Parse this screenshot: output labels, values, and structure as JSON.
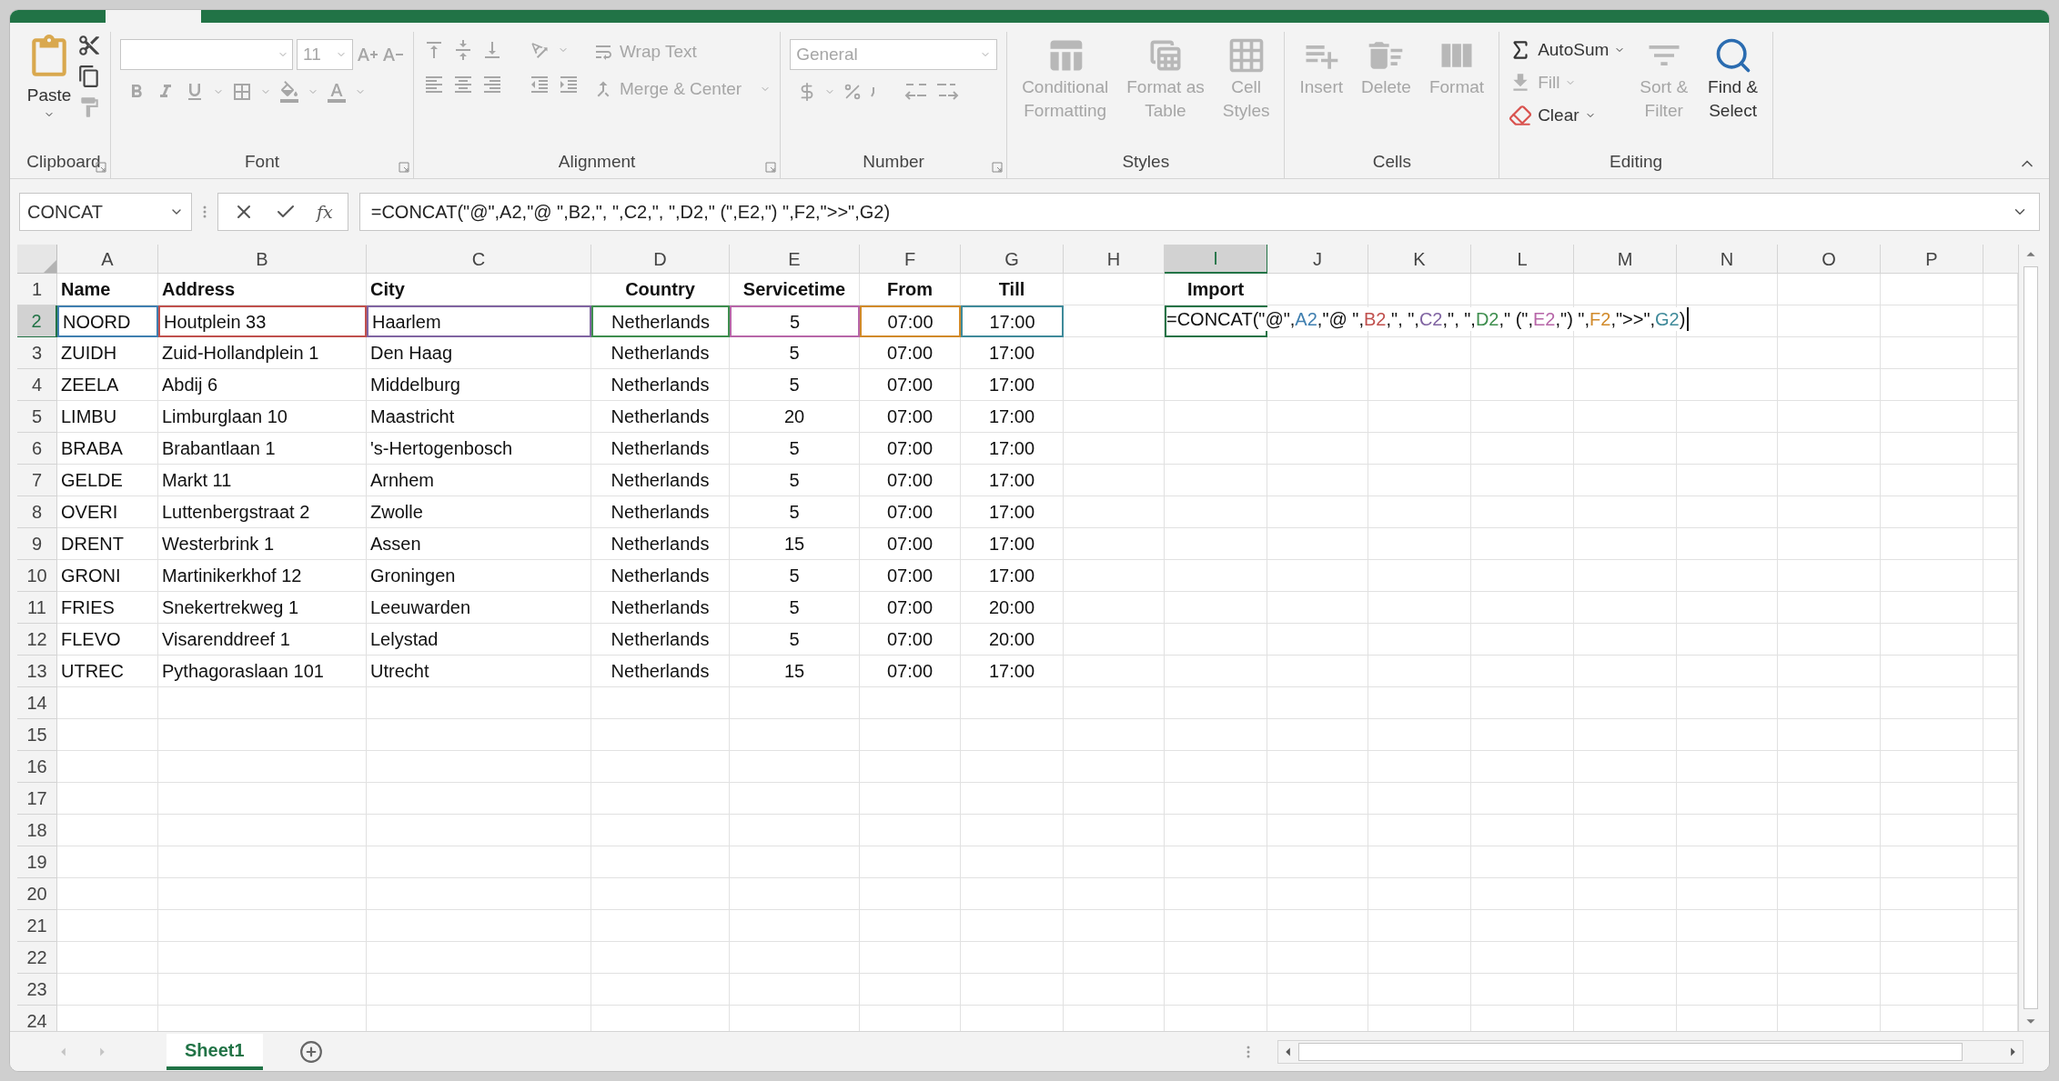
{
  "ribbon": {
    "groups": [
      {
        "kind": "clipboard",
        "label": "Clipboard",
        "launcher": true,
        "paste": {
          "label": "Paste",
          "disabled": false
        },
        "tools": [
          {
            "kind": "cut",
            "disabled": false
          },
          {
            "kind": "copy",
            "disabled": false
          },
          {
            "kind": "painter",
            "disabled": true
          }
        ]
      },
      {
        "kind": "font",
        "label": "Font",
        "launcher": true,
        "disabled": true,
        "font_size": "11"
      },
      {
        "kind": "alignment",
        "label": "Alignment",
        "launcher": true,
        "disabled": true,
        "wrap": "Wrap Text",
        "merge": "Merge & Center"
      },
      {
        "kind": "number",
        "label": "Number",
        "launcher": true,
        "disabled": true,
        "format": "General"
      },
      {
        "kind": "styles",
        "label": "Styles",
        "buttons": [
          {
            "kind": "conditional",
            "lines": [
              "Conditional",
              "Formatting"
            ],
            "disabled": true
          },
          {
            "kind": "table",
            "lines": [
              "Format as",
              "Table"
            ],
            "disabled": true
          },
          {
            "kind": "cellstyles",
            "lines": [
              "Cell",
              "Styles"
            ],
            "disabled": true
          }
        ]
      },
      {
        "kind": "cells",
        "label": "Cells",
        "buttons": [
          {
            "kind": "insert",
            "lines": [
              "Insert"
            ],
            "disabled": true
          },
          {
            "kind": "delete",
            "lines": [
              "Delete"
            ],
            "disabled": true
          },
          {
            "kind": "format",
            "lines": [
              "Format"
            ],
            "disabled": true
          }
        ]
      },
      {
        "kind": "editing",
        "label": "Editing",
        "small": [
          {
            "kind": "autosum",
            "label": "AutoSum",
            "disabled": false
          },
          {
            "kind": "fill",
            "label": "Fill",
            "disabled": true
          },
          {
            "kind": "clear",
            "label": "Clear",
            "disabled": false
          }
        ],
        "buttons": [
          {
            "kind": "sort",
            "lines": [
              "Sort &",
              "Filter"
            ],
            "disabled": true
          },
          {
            "kind": "find",
            "lines": [
              "Find &",
              "Select"
            ],
            "disabled": false
          }
        ]
      }
    ]
  },
  "formula_bar": {
    "name_box": "CONCAT",
    "fx": "fx",
    "formula": "=CONCAT(\"@\",A2,\"@ \",B2,\", \",C2,\", \",D2,\" (\",E2,\") \",F2,\">>\",G2)"
  },
  "sheet": {
    "columns": [
      {
        "label": "A",
        "selected": false
      },
      {
        "label": "B",
        "selected": false
      },
      {
        "label": "C",
        "selected": false
      },
      {
        "label": "D",
        "selected": false
      },
      {
        "label": "E",
        "selected": false
      },
      {
        "label": "F",
        "selected": false
      },
      {
        "label": "G",
        "selected": false
      },
      {
        "label": "H",
        "selected": false
      },
      {
        "label": "I",
        "selected": true
      },
      {
        "label": "J",
        "selected": false
      },
      {
        "label": "K",
        "selected": false
      },
      {
        "label": "L",
        "selected": false
      },
      {
        "label": "M",
        "selected": false
      },
      {
        "label": "N",
        "selected": false
      },
      {
        "label": "O",
        "selected": false
      },
      {
        "label": "P",
        "selected": false
      }
    ],
    "rows": [
      {
        "label": "1",
        "selected": false,
        "kind": "header",
        "cells": [
          "Name",
          "Address",
          "City",
          "Country",
          "Servicetime",
          "From",
          "Till",
          null,
          "Import"
        ]
      },
      {
        "label": "2",
        "selected": true,
        "kind": "data",
        "cells": [
          "NOORD",
          "Houtplein 33",
          "Haarlem",
          "Netherlands",
          "5",
          "07:00",
          "17:00"
        ],
        "cell_highlights": [
          {
            "color": "#3f7fb0"
          },
          {
            "color": "#c0504d"
          },
          {
            "color": "#8064a2"
          },
          {
            "color": "#3e8e4e"
          },
          {
            "color": "#b766a8"
          },
          {
            "color": "#d18a2a"
          },
          {
            "color": "#3f8a9a"
          }
        ],
        "editing": {
          "tokens": [
            {
              "kind": "text",
              "text": "=CONCAT(\"@\","
            },
            {
              "kind": "ref",
              "text": "A2",
              "color": "#3f7fb0"
            },
            {
              "kind": "text",
              "text": ",\"@ \","
            },
            {
              "kind": "ref",
              "text": "B2",
              "color": "#c0504d"
            },
            {
              "kind": "text",
              "text": ",\", \","
            },
            {
              "kind": "ref",
              "text": "C2",
              "color": "#8064a2"
            },
            {
              "kind": "text",
              "text": ",\", \","
            },
            {
              "kind": "ref",
              "text": "D2",
              "color": "#3e8e4e"
            },
            {
              "kind": "text",
              "text": ",\" (\","
            },
            {
              "kind": "ref",
              "text": "E2",
              "color": "#b766a8"
            },
            {
              "kind": "text",
              "text": ",\") \","
            },
            {
              "kind": "ref",
              "text": "F2",
              "color": "#d18a2a"
            },
            {
              "kind": "text",
              "text": ",\">>\","
            },
            {
              "kind": "ref",
              "text": "G2",
              "color": "#3f8a9a"
            },
            {
              "kind": "text",
              "text": ")"
            }
          ]
        }
      },
      {
        "label": "3",
        "selected": false,
        "kind": "data",
        "cells": [
          "ZUIDH",
          "Zuid-Hollandplein 1",
          "Den Haag",
          "Netherlands",
          "5",
          "07:00",
          "17:00"
        ]
      },
      {
        "label": "4",
        "selected": false,
        "kind": "data",
        "cells": [
          "ZEELA",
          "Abdij 6",
          "Middelburg",
          "Netherlands",
          "5",
          "07:00",
          "17:00"
        ]
      },
      {
        "label": "5",
        "selected": false,
        "kind": "data",
        "cells": [
          "LIMBU",
          "Limburglaan 10",
          "Maastricht",
          "Netherlands",
          "20",
          "07:00",
          "17:00"
        ]
      },
      {
        "label": "6",
        "selected": false,
        "kind": "data",
        "cells": [
          "BRABA",
          "Brabantlaan 1",
          "'s-Hertogenbosch",
          "Netherlands",
          "5",
          "07:00",
          "17:00"
        ]
      },
      {
        "label": "7",
        "selected": false,
        "kind": "data",
        "cells": [
          "GELDE",
          "Markt 11",
          "Arnhem",
          "Netherlands",
          "5",
          "07:00",
          "17:00"
        ]
      },
      {
        "label": "8",
        "selected": false,
        "kind": "data",
        "cells": [
          "OVERI",
          "Luttenbergstraat 2",
          "Zwolle",
          "Netherlands",
          "5",
          "07:00",
          "17:00"
        ]
      },
      {
        "label": "9",
        "selected": false,
        "kind": "data",
        "cells": [
          "DRENT",
          "Westerbrink 1",
          "Assen",
          "Netherlands",
          "15",
          "07:00",
          "17:00"
        ]
      },
      {
        "label": "10",
        "selected": false,
        "kind": "data",
        "cells": [
          "GRONI",
          "Martinikerkhof 12",
          "Groningen",
          "Netherlands",
          "5",
          "07:00",
          "17:00"
        ]
      },
      {
        "label": "11",
        "selected": false,
        "kind": "data",
        "cells": [
          "FRIES",
          "Snekertrekweg 1",
          "Leeuwarden",
          "Netherlands",
          "5",
          "07:00",
          "20:00"
        ]
      },
      {
        "label": "12",
        "selected": false,
        "kind": "data",
        "cells": [
          "FLEVO",
          "Visarenddreef 1",
          "Lelystad",
          "Netherlands",
          "5",
          "07:00",
          "20:00"
        ]
      },
      {
        "label": "13",
        "selected": false,
        "kind": "data",
        "cells": [
          "UTREC",
          "Pythagoraslaan 101",
          "Utrecht",
          "Netherlands",
          "15",
          "07:00",
          "17:00"
        ]
      },
      {
        "label": "14",
        "selected": false,
        "kind": "data"
      },
      {
        "label": "15",
        "selected": false,
        "kind": "data"
      },
      {
        "label": "16",
        "selected": false,
        "kind": "data"
      },
      {
        "label": "17",
        "selected": false,
        "kind": "data"
      },
      {
        "label": "18",
        "selected": false,
        "kind": "data"
      },
      {
        "label": "19",
        "selected": false,
        "kind": "data"
      },
      {
        "label": "20",
        "selected": false,
        "kind": "data"
      },
      {
        "label": "21",
        "selected": false,
        "kind": "data"
      },
      {
        "label": "22",
        "selected": false,
        "kind": "data"
      },
      {
        "label": "23",
        "selected": false,
        "kind": "data"
      },
      {
        "label": "24",
        "selected": false,
        "kind": "data"
      }
    ]
  },
  "sheet_tabs": [
    {
      "label": "Sheet1",
      "selected": true
    }
  ]
}
